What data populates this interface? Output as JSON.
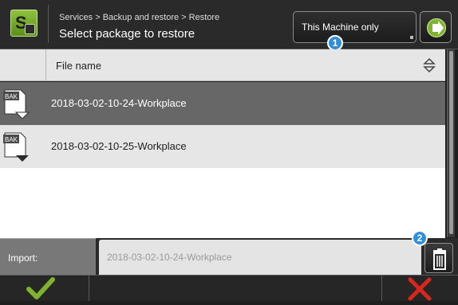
{
  "header": {
    "breadcrumb": "Services > Backup and restore > Restore",
    "title": "Select package to restore",
    "source_select": {
      "selected": "This Machine only"
    },
    "app_icon": "services-icon",
    "go_icon": "arrow-right-circle-icon"
  },
  "callouts": [
    "1",
    "2"
  ],
  "table": {
    "column_header": "File name",
    "sort_icon": "sort-up-down-icon",
    "rows": [
      {
        "icon": "bak-file-icon",
        "icon_text": "BAK",
        "name": "2018-03-02-10-24-Workplace",
        "selected": true
      },
      {
        "icon": "bak-file-icon",
        "icon_text": "BAK",
        "name": "2018-03-02-10-25-Workplace",
        "selected": false
      }
    ]
  },
  "import": {
    "label": "Import:",
    "value": "2018-03-02-10-24-Workplace",
    "delete_icon": "trash-icon"
  },
  "footer": {
    "confirm_icon": "checkmark-icon",
    "cancel_icon": "close-x-icon"
  },
  "colors": {
    "accent_green": "#7fb22e",
    "cancel_red": "#d9261c",
    "badge_blue": "#2f8fd8",
    "selected_row": "#676767"
  }
}
